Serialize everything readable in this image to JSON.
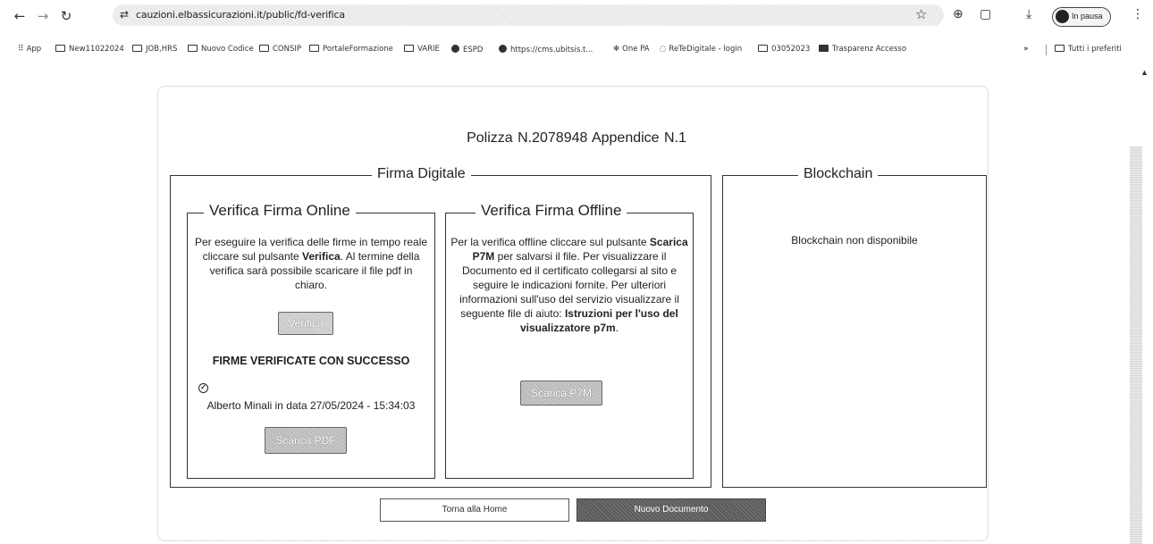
{
  "browser": {
    "url": "cauzioni.elbassicurazioni.it/public/fd-verifica",
    "profile_label": "In pausa",
    "bookmarks": [
      {
        "label": "App",
        "icon": "apps-grid-icon"
      },
      {
        "label": "New11022024",
        "icon": "folder-icon"
      },
      {
        "label": "JOB,HRS",
        "icon": "folder-icon"
      },
      {
        "label": "Nuovo Codice",
        "icon": "folder-icon"
      },
      {
        "label": "CONSIP",
        "icon": "folder-icon"
      },
      {
        "label": "PortaleFormazione",
        "icon": "folder-icon"
      },
      {
        "label": "VARIE",
        "icon": "folder-icon"
      },
      {
        "label": "ESPD",
        "icon": "globe-icon"
      },
      {
        "label": "https://cms.ubitsis.t...",
        "icon": "globe-icon"
      },
      {
        "label": "One PA",
        "icon": "onepa-icon"
      },
      {
        "label": "ReTeDigitale - login",
        "icon": "retedigitale-icon"
      },
      {
        "label": "03052023",
        "icon": "folder-icon"
      },
      {
        "label": "Trasparenz Accesso",
        "icon": "trasparenza-icon"
      }
    ],
    "overflow_label": "»",
    "all_bookmarks_label": "Tutti i preferiti"
  },
  "page": {
    "policy_title": "Polizza N.2078948  Appendice N.1",
    "firma_digitale": {
      "legend": "Firma Digitale",
      "online": {
        "legend": "Verifica Firma Online",
        "text_1": "Per eseguire la verifica delle firme in tempo reale cliccare sul pulsante ",
        "text_bold": "Verifica",
        "text_2": ". Al termine della verifica sarà possibile scaricare il file pdf in chiaro.",
        "verifica_button": "Verifica",
        "status": "FIRME VERIFICATE CON SUCCESSO",
        "signer": "Alberto Minali in data 27/05/2024 - 15:34:03",
        "download_pdf_button": "Scarica PDF"
      },
      "offline": {
        "legend": "Verifica Firma Offline",
        "text_1": "Per la verifica offline cliccare sul pulsante ",
        "text_bold_1": "Scarica P7M",
        "text_2": " per salvarsi il file. Per visualizzare il Documento ed il certificato collegarsi al sito e seguire le indicazioni fornite. Per ulteriori informazioni sull'uso del servizio visualizzare il seguente file di aiuto: ",
        "text_bold_2": "Istruzioni per l'uso del visualizzatore p7m",
        "text_3": ".",
        "download_p7m_button": "Scarica P7M"
      }
    },
    "blockchain": {
      "legend": "Blockchain",
      "status": "Blockchain non disponibile"
    },
    "home_button": "Torna alla Home",
    "new_document_button": "Nuovo Documento"
  }
}
